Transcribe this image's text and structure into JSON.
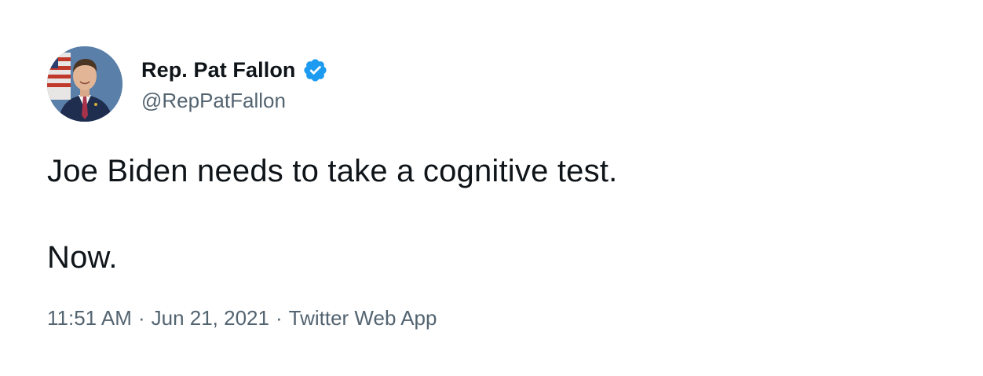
{
  "author": {
    "display_name": "Rep. Pat Fallon",
    "handle": "@RepPatFallon",
    "verified": true,
    "avatar_icon": "user-avatar-photo",
    "verified_icon": "verified-badge-icon"
  },
  "tweet": {
    "line1": "Joe Biden needs to take a cognitive test.",
    "line2": "Now."
  },
  "meta": {
    "time": "11:51 AM",
    "separator": "·",
    "date": "Jun 21, 2021",
    "source": "Twitter Web App"
  },
  "colors": {
    "text": "#0f1419",
    "secondary": "#536471",
    "verified": "#1d9bf0"
  }
}
